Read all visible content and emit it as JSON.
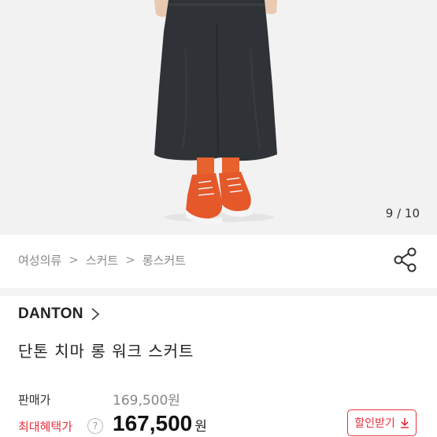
{
  "gallery": {
    "current": 9,
    "total": 10,
    "counter_text": "9 / 10"
  },
  "breadcrumb": {
    "items": [
      "여성의류",
      "스커트",
      "롱스커트"
    ],
    "separator": ">"
  },
  "product": {
    "brand": "DANTON",
    "title": "단톤 치마 롱 워크 스커트"
  },
  "price": {
    "sale_label": "판매가",
    "sale_value": "169,500원",
    "best_label": "최대혜택가",
    "help_icon": "?",
    "best_value": "167,500",
    "best_currency": "원",
    "coupon_label": "할인받기"
  },
  "colors": {
    "accent": "#e8303c",
    "background": "#f2f2f2"
  }
}
